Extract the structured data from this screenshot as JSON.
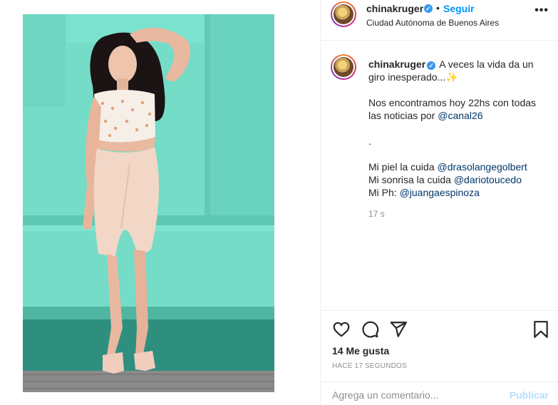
{
  "post": {
    "username": "chinakruger",
    "follow_label": "Seguir",
    "separator": "•",
    "location": "Ciudad Autónoma de Buenos Aires",
    "more_label": "•••"
  },
  "caption": {
    "username": "chinakruger",
    "first_line": "A veces la vida da un giro inesperado...",
    "emoji": "✨",
    "line2": "Nos encontramos hoy 22hs con todas las noticias por",
    "line2_mention": "@canal26",
    "line3": ".",
    "skin_label": "Mi piel la cuida",
    "skin_mention": "@drasolangegolbert",
    "smile_label": "Mi sonrisa la cuida",
    "smile_mention": "@dariotoucedo",
    "photo_label": "Mi Ph:",
    "photo_mention": "@juangaespinoza",
    "time": "17 s"
  },
  "actions": {
    "icons": [
      "heart-icon",
      "comment-icon",
      "share-icon",
      "bookmark-icon"
    ],
    "likes": "14 Me gusta",
    "ago": "HACE 17 SEGUNDOS"
  },
  "comment_box": {
    "placeholder": "Agrega un comentario...",
    "publish_label": "Publicar"
  },
  "colors": {
    "accent": "#0095f6",
    "wall": "#72dcc6",
    "verified": "#3897f0"
  }
}
